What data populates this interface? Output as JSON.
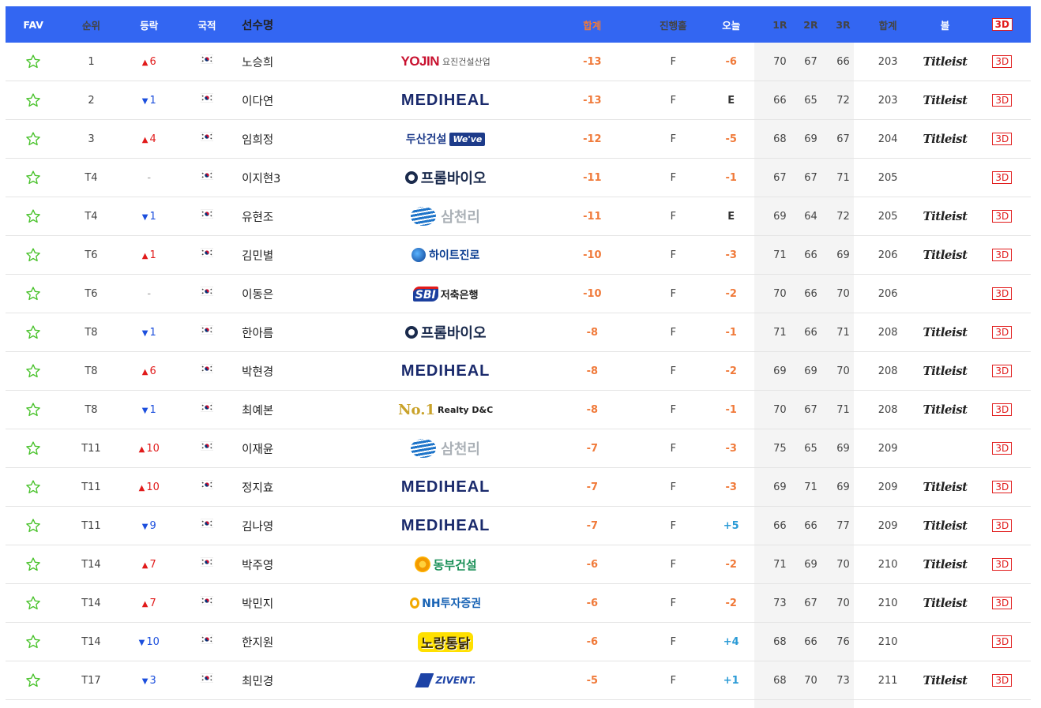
{
  "header": {
    "fav": "FAV",
    "rank": "순위",
    "move": "등락",
    "nat": "국적",
    "name": "선수명",
    "total": "합계",
    "hole": "진행홀",
    "today": "오늘",
    "r1": "1R",
    "r2": "2R",
    "r3": "3R",
    "sum": "합계",
    "ball": "볼",
    "three_d": "3D"
  },
  "colors": {
    "header_bg": "#3366f2",
    "up": "#e11b1b",
    "down": "#1c4fdd",
    "score": "#f07a3a",
    "plus": "#2b9bd6"
  },
  "rows": [
    {
      "rank": "1",
      "dir": "up",
      "move": "6",
      "name": "노승희",
      "sponsor": "yojin",
      "sponsor_text": [
        "YOJIN",
        "요진건설산업"
      ],
      "total": "-13",
      "hole": "F",
      "today": "-6",
      "today_kind": "neg",
      "r1": "70",
      "r2": "67",
      "r3": "66",
      "sum": "203",
      "ball": "Titleist",
      "three_d": "3D"
    },
    {
      "rank": "2",
      "dir": "down",
      "move": "1",
      "name": "이다연",
      "sponsor": "medi",
      "sponsor_text": [
        "MEDIHEAL"
      ],
      "total": "-13",
      "hole": "F",
      "today": "E",
      "today_kind": "even",
      "r1": "66",
      "r2": "65",
      "r3": "72",
      "sum": "203",
      "ball": "Titleist",
      "three_d": "3D"
    },
    {
      "rank": "3",
      "dir": "up",
      "move": "4",
      "name": "임희정",
      "sponsor": "doosan",
      "sponsor_text": [
        "두산건설",
        "We've"
      ],
      "total": "-12",
      "hole": "F",
      "today": "-5",
      "today_kind": "neg",
      "r1": "68",
      "r2": "69",
      "r3": "67",
      "sum": "204",
      "ball": "Titleist",
      "three_d": "3D"
    },
    {
      "rank": "T4",
      "dir": "same",
      "move": "-",
      "name": "이지현3",
      "sponsor": "prom",
      "sponsor_text": [
        "프롬바이오"
      ],
      "total": "-11",
      "hole": "F",
      "today": "-1",
      "today_kind": "neg",
      "r1": "67",
      "r2": "67",
      "r3": "71",
      "sum": "205",
      "ball": "",
      "three_d": "3D"
    },
    {
      "rank": "T4",
      "dir": "down",
      "move": "1",
      "name": "유현조",
      "sponsor": "sam",
      "sponsor_text": [
        "삼천리"
      ],
      "total": "-11",
      "hole": "F",
      "today": "E",
      "today_kind": "even",
      "r1": "69",
      "r2": "64",
      "r3": "72",
      "sum": "205",
      "ball": "Titleist",
      "three_d": "3D"
    },
    {
      "rank": "T6",
      "dir": "up",
      "move": "1",
      "name": "김민별",
      "sponsor": "hite",
      "sponsor_text": [
        "하이트진로"
      ],
      "total": "-10",
      "hole": "F",
      "today": "-3",
      "today_kind": "neg",
      "r1": "71",
      "r2": "66",
      "r3": "69",
      "sum": "206",
      "ball": "Titleist",
      "three_d": "3D"
    },
    {
      "rank": "T6",
      "dir": "same",
      "move": "-",
      "name": "이동은",
      "sponsor": "sbi",
      "sponsor_text": [
        "SBI",
        "저축은행"
      ],
      "total": "-10",
      "hole": "F",
      "today": "-2",
      "today_kind": "neg",
      "r1": "70",
      "r2": "66",
      "r3": "70",
      "sum": "206",
      "ball": "",
      "three_d": "3D"
    },
    {
      "rank": "T8",
      "dir": "down",
      "move": "1",
      "name": "한아름",
      "sponsor": "prom",
      "sponsor_text": [
        "프롬바이오"
      ],
      "total": "-8",
      "hole": "F",
      "today": "-1",
      "today_kind": "neg",
      "r1": "71",
      "r2": "66",
      "r3": "71",
      "sum": "208",
      "ball": "Titleist",
      "three_d": "3D"
    },
    {
      "rank": "T8",
      "dir": "up",
      "move": "6",
      "name": "박현경",
      "sponsor": "medi",
      "sponsor_text": [
        "MEDIHEAL"
      ],
      "total": "-8",
      "hole": "F",
      "today": "-2",
      "today_kind": "neg",
      "r1": "69",
      "r2": "69",
      "r3": "70",
      "sum": "208",
      "ball": "Titleist",
      "three_d": "3D"
    },
    {
      "rank": "T8",
      "dir": "down",
      "move": "1",
      "name": "최예본",
      "sponsor": "no1",
      "sponsor_text": [
        "No.1",
        "Realty D&C"
      ],
      "total": "-8",
      "hole": "F",
      "today": "-1",
      "today_kind": "neg",
      "r1": "70",
      "r2": "67",
      "r3": "71",
      "sum": "208",
      "ball": "Titleist",
      "three_d": "3D"
    },
    {
      "rank": "T11",
      "dir": "up",
      "move": "10",
      "name": "이재윤",
      "sponsor": "sam",
      "sponsor_text": [
        "삼천리"
      ],
      "total": "-7",
      "hole": "F",
      "today": "-3",
      "today_kind": "neg",
      "r1": "75",
      "r2": "65",
      "r3": "69",
      "sum": "209",
      "ball": "",
      "three_d": "3D"
    },
    {
      "rank": "T11",
      "dir": "up",
      "move": "10",
      "name": "정지효",
      "sponsor": "medi",
      "sponsor_text": [
        "MEDIHEAL"
      ],
      "total": "-7",
      "hole": "F",
      "today": "-3",
      "today_kind": "neg",
      "r1": "69",
      "r2": "71",
      "r3": "69",
      "sum": "209",
      "ball": "Titleist",
      "three_d": "3D"
    },
    {
      "rank": "T11",
      "dir": "down",
      "move": "9",
      "name": "김나영",
      "sponsor": "medi",
      "sponsor_text": [
        "MEDIHEAL"
      ],
      "total": "-7",
      "hole": "F",
      "today": "+5",
      "today_kind": "pos",
      "r1": "66",
      "r2": "66",
      "r3": "77",
      "sum": "209",
      "ball": "Titleist",
      "three_d": "3D"
    },
    {
      "rank": "T14",
      "dir": "up",
      "move": "7",
      "name": "박주영",
      "sponsor": "dong",
      "sponsor_text": [
        "동부건설"
      ],
      "total": "-6",
      "hole": "F",
      "today": "-2",
      "today_kind": "neg",
      "r1": "71",
      "r2": "69",
      "r3": "70",
      "sum": "210",
      "ball": "Titleist",
      "three_d": "3D"
    },
    {
      "rank": "T14",
      "dir": "up",
      "move": "7",
      "name": "박민지",
      "sponsor": "nh",
      "sponsor_text": [
        "NH투자증권"
      ],
      "total": "-6",
      "hole": "F",
      "today": "-2",
      "today_kind": "neg",
      "r1": "73",
      "r2": "67",
      "r3": "70",
      "sum": "210",
      "ball": "Titleist",
      "three_d": "3D"
    },
    {
      "rank": "T14",
      "dir": "down",
      "move": "10",
      "name": "한지원",
      "sponsor": "nora",
      "sponsor_text": [
        "노랑통닭"
      ],
      "total": "-6",
      "hole": "F",
      "today": "+4",
      "today_kind": "pos",
      "r1": "68",
      "r2": "66",
      "r3": "76",
      "sum": "210",
      "ball": "",
      "three_d": "3D"
    },
    {
      "rank": "T17",
      "dir": "down",
      "move": "3",
      "name": "최민경",
      "sponsor": "ziv",
      "sponsor_text": [
        "ZIVENT."
      ],
      "total": "-5",
      "hole": "F",
      "today": "+1",
      "today_kind": "pos",
      "r1": "68",
      "r2": "70",
      "r3": "73",
      "sum": "211",
      "ball": "Titleist",
      "three_d": "3D"
    }
  ]
}
